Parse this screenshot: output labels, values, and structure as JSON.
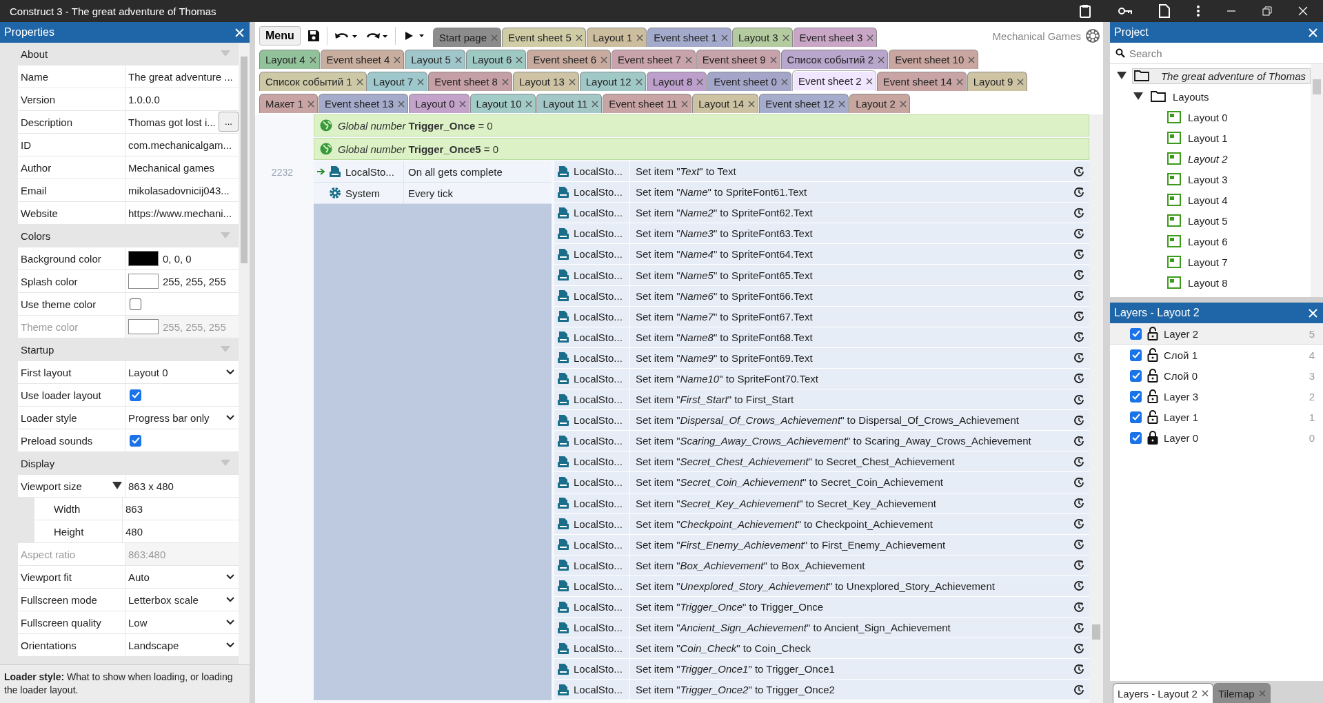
{
  "window": {
    "title": "Construct 3 - The great adventure of Thomas"
  },
  "properties": {
    "title": "Properties",
    "sections": [
      {
        "label": "About",
        "rows": [
          {
            "kind": "text",
            "label": "Name",
            "value": "The great adventure ...",
            "disabled": false
          },
          {
            "kind": "text",
            "label": "Version",
            "value": "1.0.0.0",
            "disabled": false
          },
          {
            "kind": "ellipsis",
            "label": "Description",
            "value": "Thomas got lost i...",
            "button": "...",
            "disabled": false
          },
          {
            "kind": "text",
            "label": "ID",
            "value": "com.mechanicalgam...",
            "disabled": false
          },
          {
            "kind": "text",
            "label": "Author",
            "value": "Mechanical games",
            "disabled": false
          },
          {
            "kind": "text",
            "label": "Email",
            "value": "mikolasadovnicij043...",
            "disabled": false
          },
          {
            "kind": "text",
            "label": "Website",
            "value": "https://www.mechani...",
            "disabled": false
          }
        ]
      },
      {
        "label": "Colors",
        "rows": [
          {
            "kind": "color",
            "label": "Background color",
            "color": "#000000",
            "value": "0, 0, 0",
            "disabled": false
          },
          {
            "kind": "color",
            "label": "Splash color",
            "color": "#ffffff",
            "value": "255, 255, 255",
            "disabled": false
          },
          {
            "kind": "checkbox",
            "label": "Use theme color",
            "checked": false,
            "disabled": false
          },
          {
            "kind": "color",
            "label": "Theme color",
            "color": "#ffffff",
            "value": "255, 255, 255",
            "disabled": true
          }
        ]
      },
      {
        "label": "Startup",
        "rows": [
          {
            "kind": "select",
            "label": "First layout",
            "value": "Layout 0",
            "disabled": false
          },
          {
            "kind": "checkbox",
            "label": "Use loader layout",
            "checked": true,
            "disabled": false
          },
          {
            "kind": "select",
            "label": "Loader style",
            "value": "Progress bar only",
            "disabled": false
          },
          {
            "kind": "checkbox",
            "label": "Preload sounds",
            "checked": true,
            "disabled": false
          }
        ]
      },
      {
        "label": "Display",
        "rows": [
          {
            "kind": "expander",
            "label": "Viewport size",
            "value": "863 x 480",
            "expanded": true,
            "disabled": false,
            "children": [
              {
                "label": "Width",
                "value": "863"
              },
              {
                "label": "Height",
                "value": "480"
              }
            ]
          },
          {
            "kind": "text",
            "label": "Aspect ratio",
            "value": "863:480",
            "disabled": true
          },
          {
            "kind": "select",
            "label": "Viewport fit",
            "value": "Auto",
            "disabled": false
          },
          {
            "kind": "select",
            "label": "Fullscreen mode",
            "value": "Letterbox scale",
            "disabled": false
          },
          {
            "kind": "select",
            "label": "Fullscreen quality",
            "value": "Low",
            "disabled": false
          },
          {
            "kind": "select",
            "label": "Orientations",
            "value": "Landscape",
            "disabled": false
          }
        ]
      }
    ],
    "help": {
      "text": "**Loader style:** What to show when loading, or loading the loader layout."
    }
  },
  "toolbar": {
    "menu": "Menu"
  },
  "brand": "Mechanical Games",
  "tab_rows": [
    {
      "tabs": [
        {
          "label": "Start page",
          "color": "#8c8c8c",
          "selected": false
        },
        {
          "label": "Event sheet 5",
          "color": "#cfcca6",
          "selected": false
        },
        {
          "label": "Layout 1",
          "color": "#cbbd9e",
          "selected": false
        },
        {
          "label": "Event sheet 1",
          "color": "#a3aacb",
          "selected": false
        },
        {
          "label": "Layout 3",
          "color": "#b3cb9f",
          "selected": false
        },
        {
          "label": "Event sheet 3",
          "color": "#c9a6c6",
          "selected": false
        }
      ]
    },
    {
      "tabs": [
        {
          "label": "Layout 4",
          "color": "#92c29a",
          "selected": false
        },
        {
          "label": "Event sheet 4",
          "color": "#c8ae9f",
          "selected": false
        },
        {
          "label": "Layout 5",
          "color": "#9fc6cb",
          "selected": false
        },
        {
          "label": "Layout 6",
          "color": "#9ec8c2",
          "selected": false
        },
        {
          "label": "Event sheet 6",
          "color": "#c8ab9e",
          "selected": false
        },
        {
          "label": "Event sheet 7",
          "color": "#c9a3ab",
          "selected": false
        },
        {
          "label": "Event sheet 9",
          "color": "#c6a2aa",
          "selected": false
        },
        {
          "label": "Список событий 2",
          "color": "#b9a6cc",
          "selected": false
        },
        {
          "label": "Event sheet 10",
          "color": "#c9a69f",
          "selected": false
        }
      ]
    },
    {
      "tabs": [
        {
          "label": "Список событий 1",
          "color": "#cdc8a5",
          "selected": false
        },
        {
          "label": "Layout 7",
          "color": "#9ec8cc",
          "selected": false
        },
        {
          "label": "Event sheet 8",
          "color": "#c59fa6",
          "selected": false
        },
        {
          "label": "Layout 13",
          "color": "#cec4a5",
          "selected": false
        },
        {
          "label": "Layout 12",
          "color": "#9fc8c6",
          "selected": false
        },
        {
          "label": "Layout 8",
          "color": "#bc9fcb",
          "selected": false
        },
        {
          "label": "Event sheet 0",
          "color": "#a3a6c9",
          "selected": false
        },
        {
          "label": "Event sheet 2",
          "color": "#f1e6ff",
          "selected": true
        },
        {
          "label": "Event sheet 14",
          "color": "#c9a4a4",
          "selected": false
        },
        {
          "label": "Layout 9",
          "color": "#cec4a3",
          "selected": false
        }
      ]
    },
    {
      "tabs": [
        {
          "label": "Макет 1",
          "color": "#c9a4a4",
          "selected": false
        },
        {
          "label": "Event sheet 13",
          "color": "#a5abcb",
          "selected": false
        },
        {
          "label": "Layout 0",
          "color": "#c4a3cb",
          "selected": false
        },
        {
          "label": "Layout 10",
          "color": "#a3cbc7",
          "selected": false
        },
        {
          "label": "Layout 11",
          "color": "#a3c7c7",
          "selected": false
        },
        {
          "label": "Event sheet 11",
          "color": "#c9a4a4",
          "selected": false
        },
        {
          "label": "Layout 14",
          "color": "#cdc3a3",
          "selected": false
        },
        {
          "label": "Event sheet 12",
          "color": "#a6accb",
          "selected": false
        },
        {
          "label": "Layout 2",
          "color": "#c8a6a0",
          "selected": false
        }
      ]
    }
  ],
  "event_sheet": {
    "globals": [
      {
        "text": "*Global number* **Trigger_Once** = 0"
      },
      {
        "text": "*Global number* **Trigger_Once5** = 0"
      }
    ],
    "event": {
      "number": "2232",
      "conditions": [
        {
          "kind": "storage",
          "object": "LocalSto...",
          "text": "On all gets complete",
          "trigger": true
        },
        {
          "kind": "system",
          "object": "System",
          "text": "Every tick",
          "trigger": false
        }
      ],
      "actions": [
        {
          "object": "LocalSto...",
          "text": "Set item \"*Text*\" to Text"
        },
        {
          "object": "LocalSto...",
          "text": "Set item \"*Name*\" to SpriteFont61.Text"
        },
        {
          "object": "LocalSto...",
          "text": "Set item \"*Name2*\" to SpriteFont62.Text"
        },
        {
          "object": "LocalSto...",
          "text": "Set item \"*Name3*\" to SpriteFont63.Text"
        },
        {
          "object": "LocalSto...",
          "text": "Set item \"*Name4*\" to SpriteFont64.Text"
        },
        {
          "object": "LocalSto...",
          "text": "Set item \"*Name5*\" to SpriteFont65.Text"
        },
        {
          "object": "LocalSto...",
          "text": "Set item \"*Name6*\" to SpriteFont66.Text"
        },
        {
          "object": "LocalSto...",
          "text": "Set item \"*Name7*\" to SpriteFont67.Text"
        },
        {
          "object": "LocalSto...",
          "text": "Set item \"*Name8*\" to SpriteFont68.Text"
        },
        {
          "object": "LocalSto...",
          "text": "Set item \"*Name9*\" to SpriteFont69.Text"
        },
        {
          "object": "LocalSto...",
          "text": "Set item \"*Name10*\" to SpriteFont70.Text"
        },
        {
          "object": "LocalSto...",
          "text": "Set item \"*First_Start*\" to First_Start"
        },
        {
          "object": "LocalSto...",
          "text": "Set item \"*Dispersal_Of_Crows_Achievement*\" to Dispersal_Of_Crows_Achievement"
        },
        {
          "object": "LocalSto...",
          "text": "Set item \"*Scaring_Away_Crows_Achievement*\" to Scaring_Away_Crows_Achievement"
        },
        {
          "object": "LocalSto...",
          "text": "Set item \"*Secret_Chest_Achievement*\" to Secret_Chest_Achievement"
        },
        {
          "object": "LocalSto...",
          "text": "Set item \"*Secret_Coin_Achievement*\" to Secret_Coin_Achievement"
        },
        {
          "object": "LocalSto...",
          "text": "Set item \"*Secret_Key_Achievement*\" to Secret_Key_Achievement"
        },
        {
          "object": "LocalSto...",
          "text": "Set item \"*Checkpoint_Achievement*\" to Checkpoint_Achievement"
        },
        {
          "object": "LocalSto...",
          "text": "Set item \"*First_Enemy_Achievement*\" to First_Enemy_Achievement"
        },
        {
          "object": "LocalSto...",
          "text": "Set item \"*Box_Achievement*\" to Box_Achievement"
        },
        {
          "object": "LocalSto...",
          "text": "Set item \"*Unexplored_Story_Achievement*\" to Unexplored_Story_Achievement"
        },
        {
          "object": "LocalSto...",
          "text": "Set item \"*Trigger_Once*\" to Trigger_Once"
        },
        {
          "object": "LocalSto...",
          "text": "Set item \"*Ancient_Sign_Achievement*\" to Ancient_Sign_Achievement"
        },
        {
          "object": "LocalSto...",
          "text": "Set item \"*Coin_Check*\" to Coin_Check"
        },
        {
          "object": "LocalSto...",
          "text": "Set item \"*Trigger_Once1*\" to Trigger_Once1"
        },
        {
          "object": "LocalSto...",
          "text": "Set item \"*Trigger_Once2*\" to Trigger_Once2"
        }
      ]
    }
  },
  "project": {
    "title": "Project",
    "search": {
      "placeholder": "Search"
    },
    "tree": [
      {
        "kind": "folder",
        "label": "The great adventure of Thomas",
        "expanded": true,
        "selected": true,
        "active": true,
        "children": [
          {
            "kind": "folder",
            "label": "Layouts",
            "expanded": true,
            "selected": false,
            "active": false,
            "children": [
              {
                "kind": "layout",
                "label": "Layout 0",
                "selected": false,
                "active": false
              },
              {
                "kind": "layout",
                "label": "Layout 1",
                "selected": false,
                "active": false
              },
              {
                "kind": "layout",
                "label": "Layout 2",
                "selected": false,
                "active": true
              },
              {
                "kind": "layout",
                "label": "Layout 3",
                "selected": false,
                "active": false
              },
              {
                "kind": "layout",
                "label": "Layout 4",
                "selected": false,
                "active": false
              },
              {
                "kind": "layout",
                "label": "Layout 5",
                "selected": false,
                "active": false
              },
              {
                "kind": "layout",
                "label": "Layout 6",
                "selected": false,
                "active": false
              },
              {
                "kind": "layout",
                "label": "Layout 7",
                "selected": false,
                "active": false
              },
              {
                "kind": "layout",
                "label": "Layout 8",
                "selected": false,
                "active": false
              }
            ]
          }
        ]
      }
    ]
  },
  "layers": {
    "title": "Layers - Layout 2",
    "items": [
      {
        "label": "Layer 2",
        "index": "5",
        "visible": true,
        "locked": false,
        "selected": true
      },
      {
        "label": "Слой 1",
        "index": "4",
        "visible": true,
        "locked": false,
        "selected": false
      },
      {
        "label": "Слой 0",
        "index": "3",
        "visible": true,
        "locked": false,
        "selected": false
      },
      {
        "label": "Layer 3",
        "index": "2",
        "visible": true,
        "locked": false,
        "selected": false
      },
      {
        "label": "Layer 1",
        "index": "1",
        "visible": true,
        "locked": false,
        "selected": false
      },
      {
        "label": "Layer 0",
        "index": "0",
        "visible": true,
        "locked": true,
        "selected": false
      }
    ]
  },
  "bottom_tabs": [
    {
      "label": "Layers - Layout 2",
      "selected": true
    },
    {
      "label": "Tilemap",
      "selected": false
    }
  ]
}
